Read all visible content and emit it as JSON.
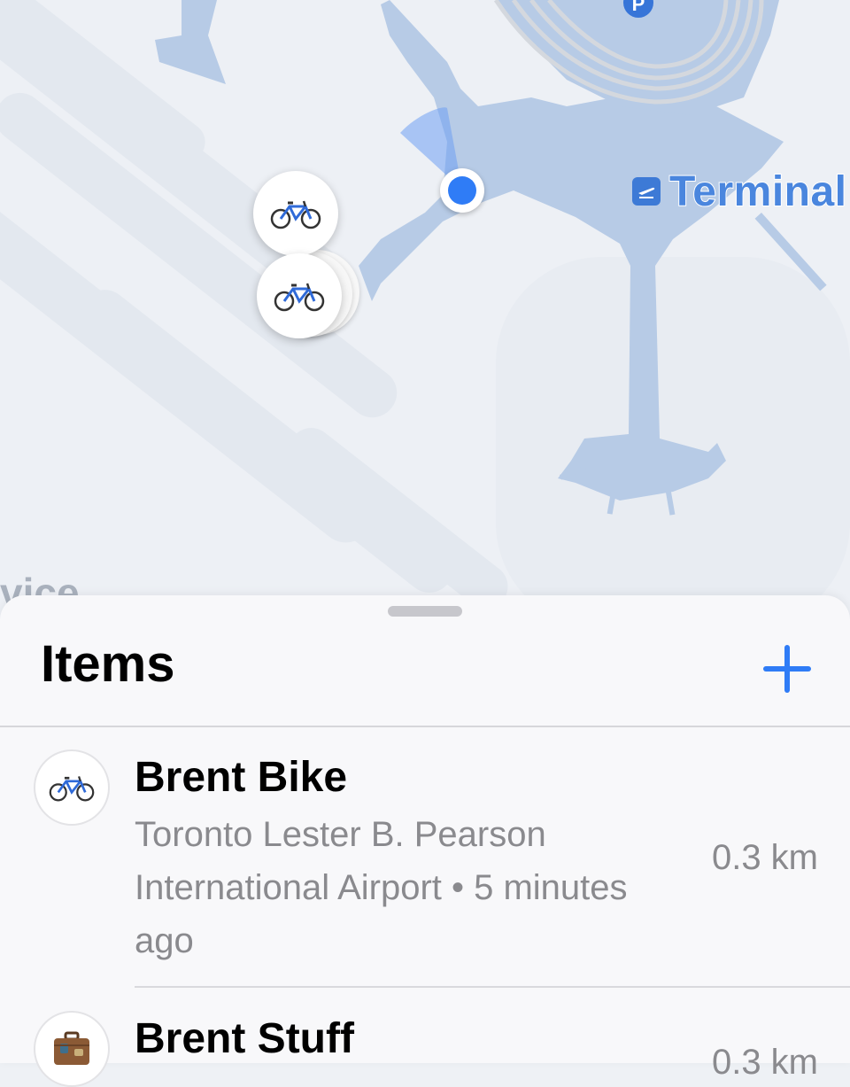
{
  "map": {
    "terminal_label": "Terminal",
    "corner_text": "vice",
    "parking_label": "P",
    "pins": [
      {
        "name": "bike-pin-1",
        "icon": "bicycle-icon"
      },
      {
        "name": "bike-pin-2",
        "icon": "bicycle-icon"
      }
    ]
  },
  "sheet": {
    "title": "Items",
    "add_icon": "plus-icon",
    "items": [
      {
        "name": "Brent Bike",
        "icon": "bicycle-icon",
        "location": "Toronto Lester B. Pearson International Airport • 5 minutes ago",
        "distance": "0.3 km"
      },
      {
        "name": "Brent Stuff",
        "icon": "suitcase-icon",
        "location": "",
        "distance": "0.3 km"
      }
    ]
  },
  "colors": {
    "accent": "#2f7cf6",
    "map_water": "#b7cbe6",
    "map_land": "#edf0f5",
    "secondary_text": "#8a8a8e"
  }
}
